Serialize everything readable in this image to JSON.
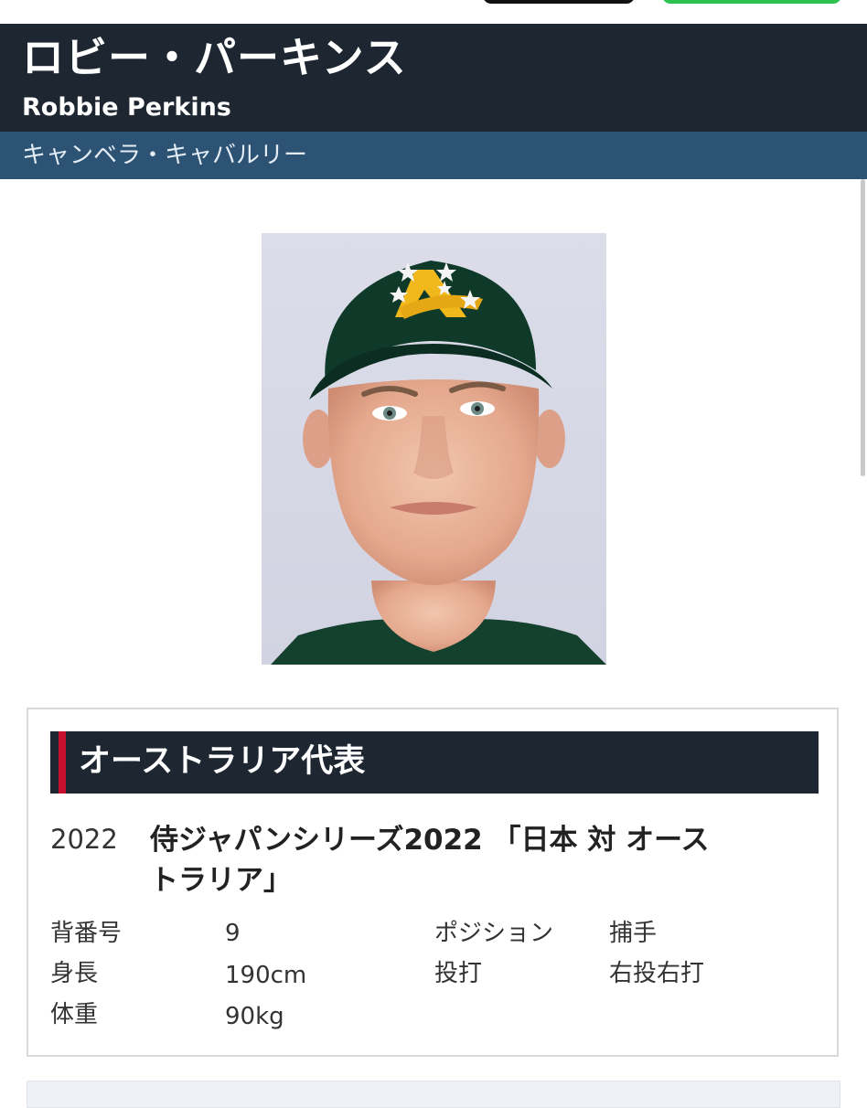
{
  "player": {
    "name_ja": "ロビー・パーキンス",
    "name_en": "Robbie Perkins",
    "team": "キャンベラ・キャバルリー"
  },
  "photo": {
    "cap_color": "#0f3a2a",
    "logo_color": "#f0b81b",
    "background": "#dcdde9"
  },
  "section": {
    "title": "オーストラリア代表",
    "accent_color": "#c8102e"
  },
  "history": {
    "year": "2022",
    "series_line1": "侍ジャパンシリーズ2022 「日本 対 オース",
    "series_line2": "トラリア」"
  },
  "profile": [
    {
      "label": "背番号",
      "value": "9"
    },
    {
      "label": "身長",
      "value": "190cm"
    },
    {
      "label": "体重",
      "value": "90kg"
    },
    {
      "label": "ポジション",
      "value": "捕手"
    },
    {
      "label": "投打",
      "value": "右投右打"
    }
  ],
  "colors": {
    "header_bg": "#1d2631",
    "team_bar_bg": "#2c5274",
    "accent": "#c8102e"
  }
}
